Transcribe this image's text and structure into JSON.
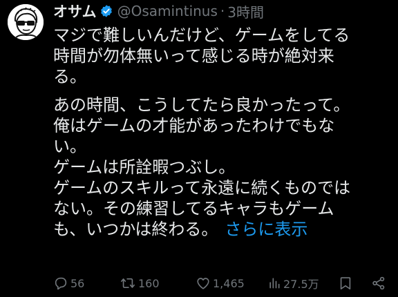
{
  "tweet": {
    "display_name": "オサム",
    "handle": "@Osamintinus",
    "separator": "·",
    "time": "3時間",
    "lines": [
      "マジで難しいんだけど、ゲームをしてる",
      "時間が勿体無いって感じる時が絶対来",
      "る。",
      "あの時間、こうしてたら良かったって。",
      "俺はゲームの才能があったわけでもな",
      "い。",
      "ゲームは所詮暇つぶし。",
      "ゲームのスキルって永遠に続くものでは",
      "ない。その練習してるキャラもゲーム",
      "も、いつかは終わる。"
    ],
    "show_more": "さらに表示"
  },
  "actions": {
    "replies": "56",
    "retweets": "160",
    "likes": "1,465",
    "views": "27.5万"
  },
  "colors": {
    "background": "#000000",
    "text": "#e7e9ea",
    "secondary": "#71767b",
    "accent": "#1d9bf0"
  },
  "icons": [
    "avatar-image",
    "verified-badge-icon",
    "reply-icon",
    "retweet-icon",
    "like-icon",
    "views-icon",
    "bookmark-icon",
    "share-icon"
  ]
}
